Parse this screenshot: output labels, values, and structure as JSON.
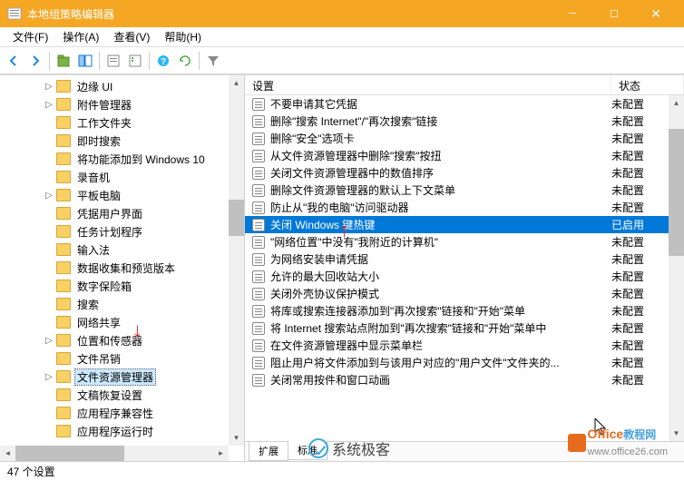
{
  "titlebar": {
    "title": "本地组策略编辑器"
  },
  "menubar": [
    "文件(F)",
    "操作(A)",
    "查看(V)",
    "帮助(H)"
  ],
  "toolbar_icons": [
    "back-icon",
    "forward-icon",
    "up-icon",
    "show-hide-tree-icon",
    "properties-icon",
    "export-list-icon",
    "help-icon",
    "refresh-icon",
    "filter-icon"
  ],
  "tree_items": [
    {
      "label": "边缘 UI",
      "exp": "▷"
    },
    {
      "label": "附件管理器",
      "exp": "▷"
    },
    {
      "label": "工作文件夹",
      "exp": ""
    },
    {
      "label": "即时搜索",
      "exp": ""
    },
    {
      "label": "将功能添加到 Windows 10",
      "exp": ""
    },
    {
      "label": "录音机",
      "exp": ""
    },
    {
      "label": "平板电脑",
      "exp": "▷"
    },
    {
      "label": "凭据用户界面",
      "exp": ""
    },
    {
      "label": "任务计划程序",
      "exp": ""
    },
    {
      "label": "输入法",
      "exp": ""
    },
    {
      "label": "数据收集和预览版本",
      "exp": ""
    },
    {
      "label": "数字保险箱",
      "exp": ""
    },
    {
      "label": "搜索",
      "exp": ""
    },
    {
      "label": "网络共享",
      "exp": ""
    },
    {
      "label": "位置和传感器",
      "exp": "▷"
    },
    {
      "label": "文件吊销",
      "exp": ""
    },
    {
      "label": "文件资源管理器",
      "exp": "▷",
      "selected": true
    },
    {
      "label": "文稿恢复设置",
      "exp": ""
    },
    {
      "label": "应用程序兼容性",
      "exp": ""
    },
    {
      "label": "应用程序运行时",
      "exp": ""
    }
  ],
  "list_header": {
    "setting": "设置",
    "state": "状态"
  },
  "list_rows": [
    {
      "setting": "不要申请其它凭据",
      "state": "未配置"
    },
    {
      "setting": "删除\"搜索 Internet\"/\"再次搜索\"链接",
      "state": "未配置"
    },
    {
      "setting": "删除\"安全\"选项卡",
      "state": "未配置"
    },
    {
      "setting": "从文件资源管理器中删除\"搜索\"按扭",
      "state": "未配置"
    },
    {
      "setting": "关闭文件资源管理器中的数值排序",
      "state": "未配置"
    },
    {
      "setting": "删除文件资源管理器的默认上下文菜单",
      "state": "未配置"
    },
    {
      "setting": "防止从\"我的电脑\"访问驱动器",
      "state": "未配置"
    },
    {
      "setting": "关闭 Windows 键热键",
      "state": "已启用",
      "selected": true
    },
    {
      "setting": "\"网络位置\"中没有\"我附近的计算机\"",
      "state": "未配置"
    },
    {
      "setting": "为网络安装申请凭据",
      "state": "未配置"
    },
    {
      "setting": "允许的最大回收站大小",
      "state": "未配置"
    },
    {
      "setting": "关闭外壳协议保护模式",
      "state": "未配置"
    },
    {
      "setting": "将库或搜索连接器添加到\"再次搜索\"链接和\"开始\"菜单",
      "state": "未配置"
    },
    {
      "setting": "将 Internet 搜索站点附加到\"再次搜索\"链接和\"开始\"菜单中",
      "state": "未配置"
    },
    {
      "setting": "在文件资源管理器中显示菜单栏",
      "state": "未配置"
    },
    {
      "setting": "阻止用户将文件添加到与该用户对应的\"用户文件\"文件夹的...",
      "state": "未配置"
    },
    {
      "setting": "关闭常用按件和窗口动画",
      "state": "未配置"
    }
  ],
  "tabs": {
    "extended": "扩展",
    "standard": "标准"
  },
  "statusbar": {
    "text": "47 个设置"
  },
  "watermarks": {
    "left": "系统极客",
    "right1": "Office",
    "right2": "教程网",
    "right3": "www.office26.com"
  }
}
